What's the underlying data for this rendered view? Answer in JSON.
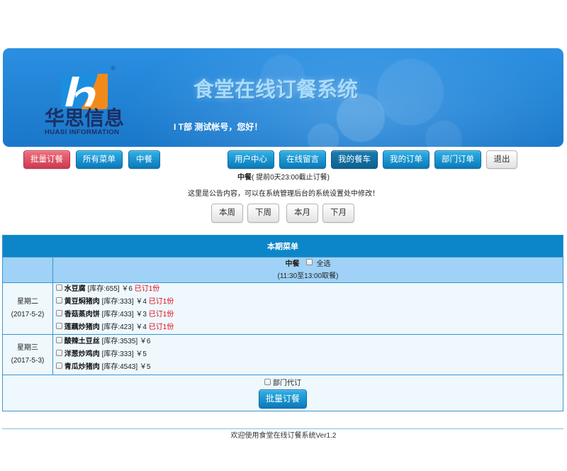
{
  "theme": {
    "banner_top": "#2b8fe1",
    "banner_bottom": "#1a77c9",
    "title_text": "#a7dcfd",
    "logo_text": "#1c2f63",
    "btn_blue_top": "#2fb0e6",
    "btn_blue_bottom": "#0b79b8",
    "btn_red_top": "#ef6e7e",
    "btn_red_bottom": "#cd3b50",
    "btn_dark_top": "#1a7bb2",
    "btn_dark_bottom": "#0c6290",
    "table_header": "#0c86c8",
    "table_subheader": "#9fd2f6",
    "table_row": "#eef8fd",
    "table_border": "#3b94d0",
    "ordered_text": "#e60012",
    "footer_rule": "#7fbde6"
  },
  "header": {
    "logo": {
      "name_cn": "华思信息",
      "name_en": "HUASI INFORMATION",
      "registered": "®"
    },
    "title": "食堂在线订餐系统",
    "greeting": {
      "dept": "I T部",
      "message": "测试帐号，您好！"
    }
  },
  "nav": {
    "left": [
      {
        "label": "批量订餐"
      },
      {
        "label": "所有菜单"
      },
      {
        "label": "中餐"
      }
    ],
    "right": [
      {
        "label": "用户中心"
      },
      {
        "label": "在线留言"
      },
      {
        "label": "我的餐车"
      },
      {
        "label": "我的订单"
      },
      {
        "label": "部门订单"
      },
      {
        "label": "退出"
      }
    ]
  },
  "deadline": {
    "meal": "中餐",
    "note": "( 提前0天23:00截止订餐)"
  },
  "notice": "这里是公告内容，可以在系统管理后台的系统设置处中修改！",
  "period": [
    "本周",
    "下周",
    "本月",
    "下月"
  ],
  "menu": {
    "title": "本期菜单",
    "meal": "中餐",
    "select_all": "全选",
    "pickup": "(11:30至13:00取餐)",
    "days": [
      {
        "weekday": "星期二",
        "date": "(2017-5-2)",
        "items": [
          {
            "name": "水豆腐",
            "stock": "[库存:655]",
            "price": "￥6",
            "ordered": "已订1份"
          },
          {
            "name": "黄豆焖猪肉",
            "stock": "[库存:333]",
            "price": "￥4",
            "ordered": "已订1份"
          },
          {
            "name": "香菇蒸肉饼",
            "stock": "[库存:433]",
            "price": "￥3",
            "ordered": "已订1份"
          },
          {
            "name": "莲藕炒猪肉",
            "stock": "[库存:423]",
            "price": "￥4",
            "ordered": "已订1份"
          }
        ]
      },
      {
        "weekday": "星期三",
        "date": "(2017-5-3)",
        "items": [
          {
            "name": "酸辣土豆丝",
            "stock": "[库存:3535]",
            "price": "￥6"
          },
          {
            "name": "洋葱炒鸡肉",
            "stock": "[库存:333]",
            "price": "￥5"
          },
          {
            "name": "青瓜炒猪肉",
            "stock": "[库存:4543]",
            "price": "￥5"
          }
        ]
      }
    ],
    "dept_order": "部门代订",
    "submit": "批量订餐"
  },
  "footer": "欢迎使用食堂在线订餐系统Ver1.2"
}
